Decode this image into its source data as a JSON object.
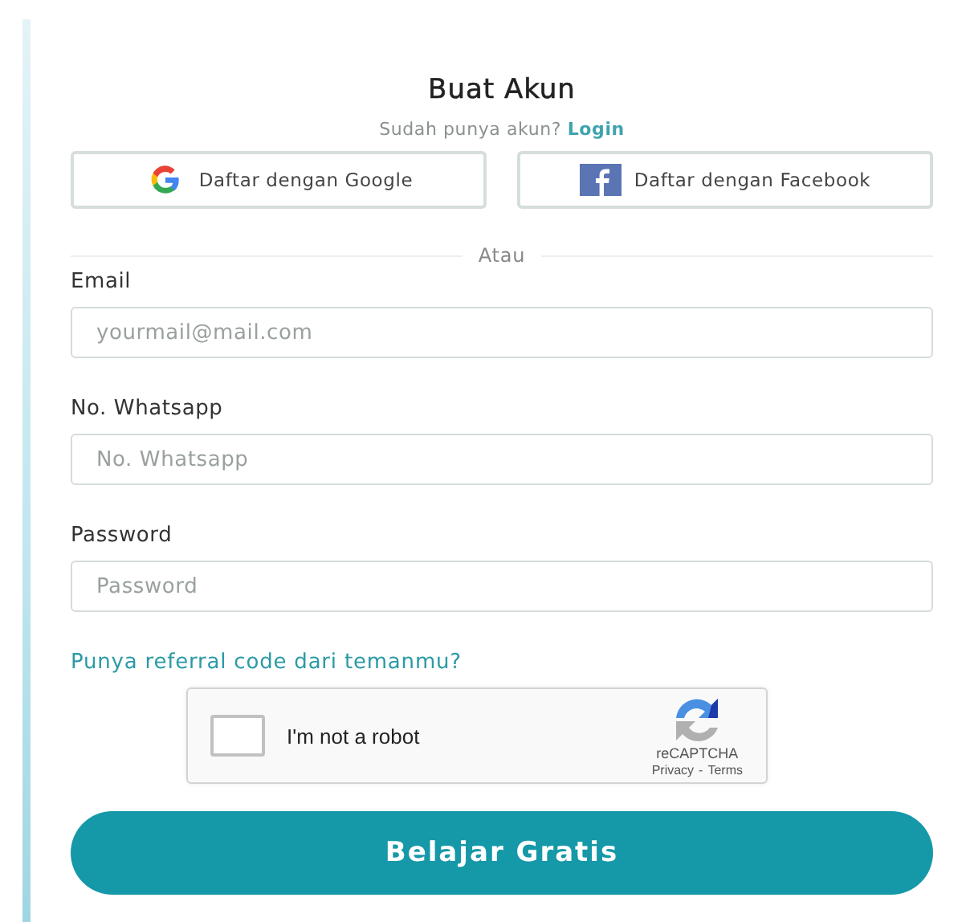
{
  "title": "Buat Akun",
  "login_prompt": {
    "text": "Sudah punya akun?",
    "link": "Login"
  },
  "social_buttons": [
    {
      "kind": "google",
      "label": "Daftar dengan Google"
    },
    {
      "kind": "facebook",
      "label": "Daftar dengan Facebook"
    }
  ],
  "divider": "Atau",
  "fields": [
    {
      "label": "Email",
      "placeholder": "yourmail@mail.com"
    },
    {
      "label": "No. Whatsapp",
      "placeholder": "No. Whatsapp"
    },
    {
      "label": "Password",
      "placeholder": "Password"
    }
  ],
  "referral_link": "Punya referral code dari temanmu?",
  "captcha": {
    "label": "I'm not a robot",
    "checked": false,
    "brand": "reCAPTCHA",
    "links": [
      "Privacy",
      "-",
      "Terms"
    ]
  },
  "submit": "Belajar Gratis"
}
